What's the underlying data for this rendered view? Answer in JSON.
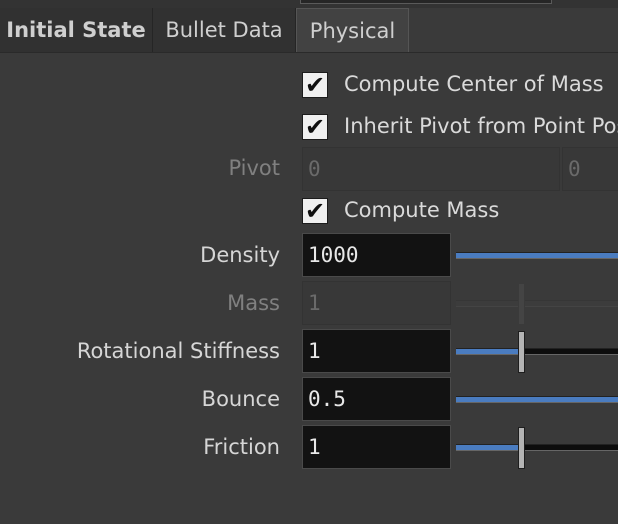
{
  "tabs": [
    {
      "label": "Initial State",
      "active": false
    },
    {
      "label": "Bullet Data",
      "active": false
    },
    {
      "label": "Physical",
      "active": true
    }
  ],
  "checkboxes": {
    "compute_center_of_mass": {
      "label": "Compute Center of Mass",
      "checked": true
    },
    "inherit_pivot": {
      "label": "Inherit Pivot from Point Pos",
      "checked": true
    },
    "compute_mass": {
      "label": "Compute Mass",
      "checked": true
    }
  },
  "pivot": {
    "label": "Pivot",
    "x": "0",
    "y": "0",
    "enabled": false
  },
  "params": [
    {
      "key": "density",
      "label": "Density",
      "value": "1000",
      "enabled": true,
      "slider_fraction": 1.0
    },
    {
      "key": "mass",
      "label": "Mass",
      "value": "1",
      "enabled": false,
      "slider_fraction": 0.4
    },
    {
      "key": "rotational_stiffness",
      "label": "Rotational Stiffness",
      "value": "1",
      "enabled": true,
      "slider_fraction": 0.4
    },
    {
      "key": "bounce",
      "label": "Bounce",
      "value": "0.5",
      "enabled": true,
      "slider_fraction": 1.0
    },
    {
      "key": "friction",
      "label": "Friction",
      "value": "1",
      "enabled": true,
      "slider_fraction": 0.4
    }
  ],
  "colors": {
    "slider_fill": "#4a7cc0",
    "background": "#3a3a3a",
    "field_bg": "#121212"
  }
}
